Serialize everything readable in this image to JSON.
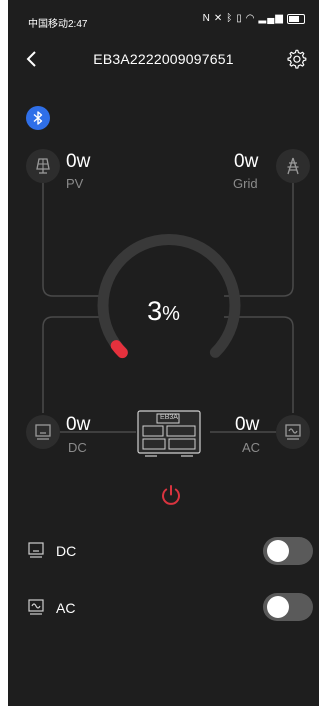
{
  "status_bar": {
    "carrier_time": "中国移动2:47",
    "icons": [
      "nfc-icon",
      "mute-icon",
      "bluetooth-icon",
      "vibrate-icon",
      "wifi-icon",
      "signal-icon",
      "battery-icon"
    ]
  },
  "header": {
    "title": "EB3A2222009097651"
  },
  "colors": {
    "background": "#1e1e1e",
    "bluetooth": "#2f6fe8",
    "battery_arc": "#e5313d",
    "power": "#d9343f",
    "toggle_off": "#5a5a5a"
  },
  "inputs": {
    "pv": {
      "value": "0w",
      "label": "PV"
    },
    "grid": {
      "value": "0w",
      "label": "Grid"
    }
  },
  "battery": {
    "percent": 3,
    "percent_number": "3",
    "unit": "%"
  },
  "outputs": {
    "dc": {
      "value": "0w",
      "label": "DC"
    },
    "ac": {
      "value": "0w",
      "label": "AC"
    }
  },
  "device": {
    "badge": "EB3A"
  },
  "switches": [
    {
      "label": "DC",
      "on": false
    },
    {
      "label": "AC",
      "on": false
    }
  ]
}
